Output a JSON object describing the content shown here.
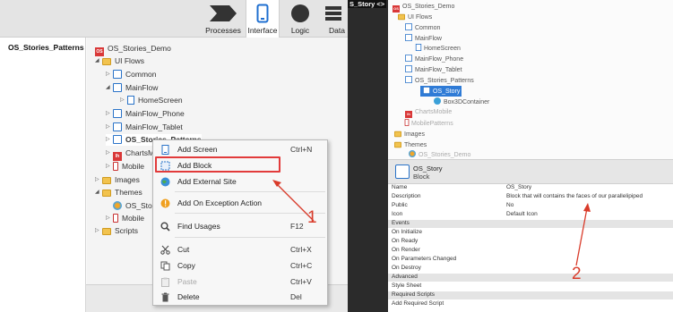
{
  "toolbar": {
    "tabs": [
      {
        "label": "Processes",
        "icon": "processes-icon"
      },
      {
        "label": "Interface",
        "icon": "interface-icon"
      },
      {
        "label": "Logic",
        "icon": "logic-icon"
      },
      {
        "label": "Data",
        "icon": "data-icon"
      }
    ],
    "active_tab": "Interface"
  },
  "left_panel": {
    "header": "OS_Stories_Patterns"
  },
  "tree": {
    "items": [
      {
        "label": "OS_Stories_Demo"
      },
      {
        "label": "UI Flows"
      },
      {
        "label": "Common"
      },
      {
        "label": "MainFlow"
      },
      {
        "label": "HomeScreen"
      },
      {
        "label": "MainFlow_Phone"
      },
      {
        "label": "MainFlow_Tablet"
      },
      {
        "label": "OS_Stories_Patterns"
      },
      {
        "label": "ChartsM"
      },
      {
        "label": "Mobile"
      },
      {
        "label": "Images"
      },
      {
        "label": "Themes"
      },
      {
        "label": "OS_Sto"
      },
      {
        "label": "Mobile"
      },
      {
        "label": "Scripts"
      }
    ]
  },
  "context_menu": {
    "items": [
      {
        "label": "Add Screen",
        "shortcut": "Ctrl+N",
        "icon": "add-screen-icon",
        "enabled": true
      },
      {
        "label": "Add Block",
        "shortcut": "",
        "icon": "add-block-icon",
        "enabled": true
      },
      {
        "label": "Add External Site",
        "shortcut": "",
        "icon": "globe-icon",
        "enabled": true
      },
      {
        "label": "Add On Exception Action",
        "shortcut": "",
        "icon": "exception-icon",
        "enabled": true
      },
      {
        "label": "Find Usages",
        "shortcut": "F12",
        "icon": "search-icon",
        "enabled": true
      },
      {
        "label": "Cut",
        "shortcut": "Ctrl+X",
        "icon": "scissors-icon",
        "enabled": true
      },
      {
        "label": "Copy",
        "shortcut": "Ctrl+C",
        "icon": "copy-icon",
        "enabled": true
      },
      {
        "label": "Paste",
        "shortcut": "Ctrl+V",
        "icon": "paste-icon",
        "enabled": false
      },
      {
        "label": "Delete",
        "shortcut": "Del",
        "icon": "trash-icon",
        "enabled": true
      }
    ]
  },
  "annotations": {
    "one": "1",
    "two": "2",
    "color": "#d93b2a"
  },
  "divider": {
    "text": "S_Story  <>"
  },
  "right_tree": {
    "items": [
      {
        "label": "OS_Stories_Demo"
      },
      {
        "label": "UI Flows"
      },
      {
        "label": "Common"
      },
      {
        "label": "MainFlow"
      },
      {
        "label": "HomeScreen"
      },
      {
        "label": "MainFlow_Phone"
      },
      {
        "label": "MainFlow_Tablet"
      },
      {
        "label": "OS_Stories_Patterns"
      },
      {
        "label": "OS_Story"
      },
      {
        "label": "Box3DContainer"
      },
      {
        "label": "ChartsMobile"
      },
      {
        "label": "MobilePatterns"
      },
      {
        "label": "Images"
      },
      {
        "label": "Themes"
      },
      {
        "label": "OS_Stories_Demo"
      }
    ]
  },
  "right_header": {
    "name": "OS_Story",
    "type": "Block"
  },
  "properties": [
    {
      "key": "Name",
      "value": "OS_Story",
      "group": false
    },
    {
      "key": "Description",
      "value": "Block that will contains the faces of our parallelipiped",
      "group": false
    },
    {
      "key": "Public",
      "value": "No",
      "group": false
    },
    {
      "key": "Icon",
      "value": "Default Icon",
      "group": false
    },
    {
      "key": "Events",
      "value": "",
      "group": true
    },
    {
      "key": "On Initialize",
      "value": "",
      "group": false
    },
    {
      "key": "On Ready",
      "value": "",
      "group": false
    },
    {
      "key": "On Render",
      "value": "",
      "group": false
    },
    {
      "key": "On Parameters Changed",
      "value": "",
      "group": false
    },
    {
      "key": "On Destroy",
      "value": "",
      "group": false
    },
    {
      "key": "Advanced",
      "value": "",
      "group": true
    },
    {
      "key": "Style Sheet",
      "value": "",
      "group": false
    },
    {
      "key": "Required Scripts",
      "value": "",
      "group": true
    },
    {
      "key": "Add Required Script",
      "value": "",
      "group": false
    }
  ]
}
